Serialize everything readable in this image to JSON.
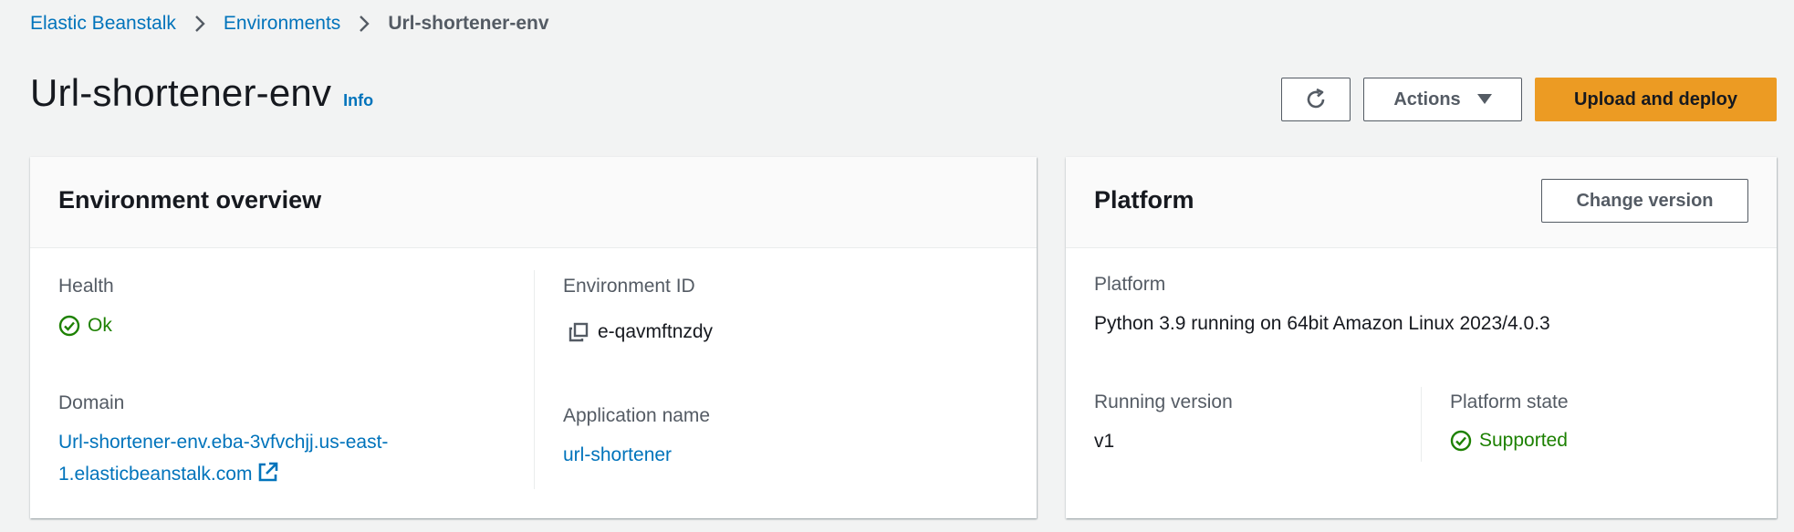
{
  "breadcrumb": {
    "items": [
      "Elastic Beanstalk",
      "Environments"
    ],
    "current": "Url-shortener-env"
  },
  "page": {
    "title": "Url-shortener-env",
    "info_label": "Info"
  },
  "toolbar": {
    "actions_label": "Actions",
    "primary_label": "Upload and deploy"
  },
  "overview": {
    "title": "Environment overview",
    "health_label": "Health",
    "health_value": "Ok",
    "env_id_label": "Environment ID",
    "env_id_value": "e-qavmftnzdy",
    "domain_label": "Domain",
    "domain_line1": "Url-shortener-env.eba-3vfvchjj.us-east-",
    "domain_line2": "1.elasticbeanstalk.com",
    "app_name_label": "Application name",
    "app_name_value": "url-shortener"
  },
  "platform": {
    "title": "Platform",
    "change_label": "Change version",
    "platform_label": "Platform",
    "platform_value": "Python 3.9 running on 64bit Amazon Linux 2023/4.0.3",
    "running_label": "Running version",
    "running_value": "v1",
    "state_label": "Platform state",
    "state_value": "Supported"
  },
  "icons": {
    "breadcrumb_separator": "chevron-right-icon",
    "refresh": "refresh-icon",
    "actions_caret": "caret-down-icon",
    "status_ok": "status-check-icon",
    "copy": "copy-icon",
    "external": "external-link-icon"
  },
  "colors": {
    "link": "#0073bb",
    "primary_button": "#ec9b23",
    "success": "#1d8102",
    "background": "#f2f3f3"
  }
}
